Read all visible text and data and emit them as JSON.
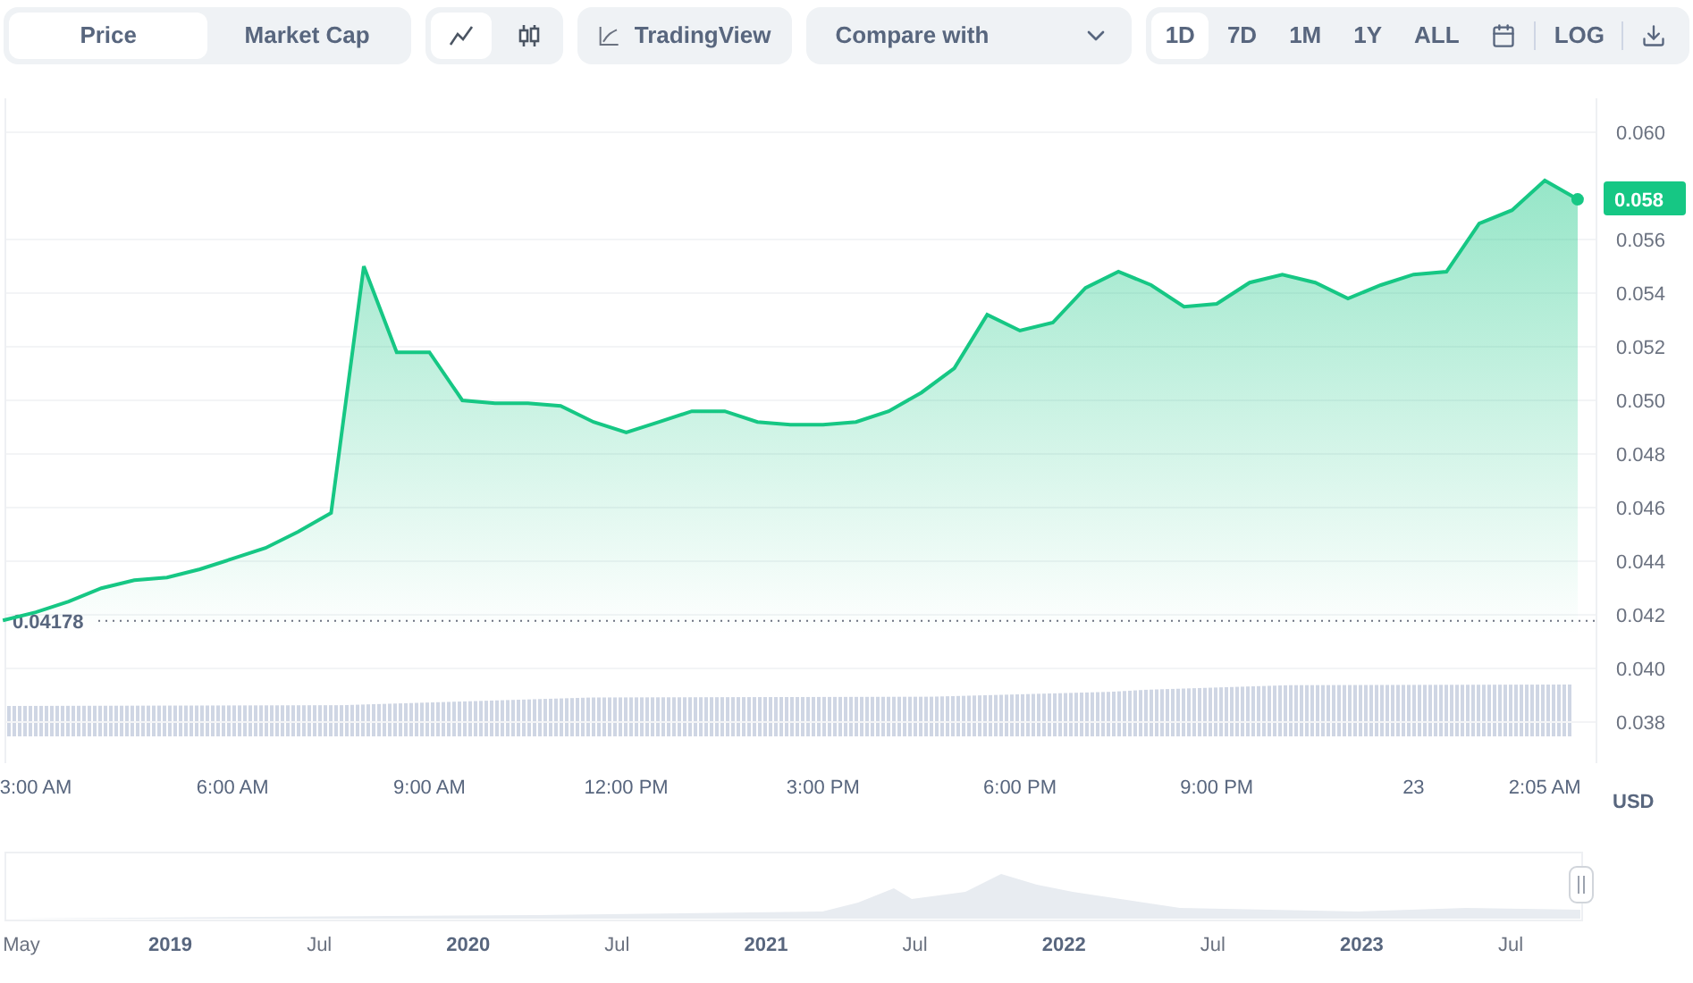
{
  "toggle": [
    {
      "label": "Price",
      "selected": true
    },
    {
      "label": "Market Cap",
      "selected": false
    }
  ],
  "chart_types": [
    {
      "kind": "line",
      "selected": true
    },
    {
      "kind": "candles",
      "selected": false
    }
  ],
  "tradingview": {
    "label": "TradingView"
  },
  "compare": {
    "placeholder": "Compare with"
  },
  "ranges": [
    {
      "label": "1D",
      "selected": true
    },
    {
      "label": "7D",
      "selected": false
    },
    {
      "label": "1M",
      "selected": false
    },
    {
      "label": "1Y",
      "selected": false
    },
    {
      "label": "ALL",
      "selected": false
    }
  ],
  "log": {
    "label": "LOG"
  },
  "chart": {
    "current_price": "0.058",
    "currency": "USD",
    "chart_data": {
      "type": "area",
      "grid": true,
      "ref_lines": [
        {
          "axis": "y",
          "value": 0.04178,
          "label": "0.04178"
        }
      ],
      "categories": [
        null,
        "3:00 AM",
        null,
        null,
        null,
        null,
        null,
        "6:00 AM",
        null,
        null,
        null,
        null,
        null,
        "9:00 AM",
        null,
        null,
        null,
        null,
        null,
        "12:00 PM",
        null,
        null,
        null,
        null,
        null,
        "3:00 PM",
        null,
        null,
        null,
        null,
        null,
        "6:00 PM",
        null,
        null,
        null,
        null,
        null,
        "9:00 PM",
        null,
        null,
        null,
        null,
        null,
        "23",
        null,
        null,
        null,
        "2:05 AM",
        null
      ],
      "series": [
        {
          "color": "#16c784",
          "values": [
            0.0418,
            0.0421,
            0.0425,
            0.043,
            0.0433,
            0.0434,
            0.0437,
            0.0441,
            0.0445,
            0.0451,
            0.0458,
            0.055,
            0.0518,
            0.0518,
            0.05,
            0.0499,
            0.0499,
            0.0498,
            0.0492,
            0.0488,
            0.0492,
            0.0496,
            0.0496,
            0.0492,
            0.0491,
            0.0491,
            0.0492,
            0.0496,
            0.0503,
            0.0512,
            0.0532,
            0.0526,
            0.0529,
            0.0542,
            0.0548,
            0.0543,
            0.0535,
            0.0536,
            0.0544,
            0.0547,
            0.0544,
            0.0538,
            0.0543,
            0.0547,
            0.0548,
            0.0566,
            0.0571,
            0.0582,
            0.0575
          ]
        }
      ],
      "ylim": [
        0.03647,
        0.06127
      ],
      "yticks": [
        {
          "value": 0.06,
          "label": "0.060"
        },
        {
          "value": 0.056,
          "label": "0.056"
        },
        {
          "value": 0.054,
          "label": "0.054"
        },
        {
          "value": 0.052,
          "label": "0.052"
        },
        {
          "value": 0.05,
          "label": "0.050"
        },
        {
          "value": 0.048,
          "label": "0.048"
        },
        {
          "value": 0.046,
          "label": "0.046"
        },
        {
          "value": 0.044,
          "label": "0.044"
        },
        {
          "value": 0.042,
          "label": "0.042"
        },
        {
          "value": 0.04,
          "label": "0.040"
        },
        {
          "value": 0.038,
          "label": "0.038"
        }
      ]
    }
  },
  "navigator": {
    "labels": [
      {
        "label": "May",
        "kind": "month"
      },
      {
        "label": "2019",
        "kind": "year"
      },
      {
        "label": "Jul",
        "kind": "month"
      },
      {
        "label": "2020",
        "kind": "year"
      },
      {
        "label": "Jul",
        "kind": "month"
      },
      {
        "label": "2021",
        "kind": "year"
      },
      {
        "label": "Jul",
        "kind": "month"
      },
      {
        "label": "2022",
        "kind": "year"
      },
      {
        "label": "Jul",
        "kind": "month"
      },
      {
        "label": "2023",
        "kind": "year"
      },
      {
        "label": "Jul",
        "kind": "month"
      }
    ]
  }
}
